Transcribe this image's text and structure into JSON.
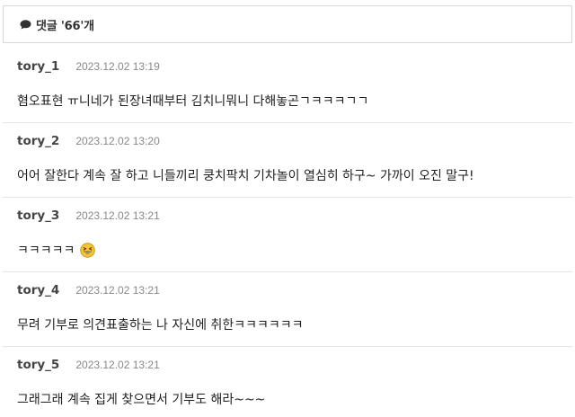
{
  "header": {
    "icon": "comment-bubble-icon",
    "title": "댓글 '66'개"
  },
  "comments": [
    {
      "author": "tory_1",
      "date": "2023.12.02 13:19",
      "text": "혐오표현 ㅠ니네가 된장녀때부터 김치니뭐니 다해놓곤ㄱㅋㅋㅋㄱㄱ"
    },
    {
      "author": "tory_2",
      "date": "2023.12.02 13:20",
      "text": "어어 잘한다 계속 잘 하고 니들끼리 쿵치팍치 기차놀이 열심히 하구~ 가까이 오진 말구!"
    },
    {
      "author": "tory_3",
      "date": "2023.12.02 13:21",
      "text": "ㅋㅋㅋㅋㅋ",
      "emoji": "grinning-squint-emoji"
    },
    {
      "author": "tory_4",
      "date": "2023.12.02 13:21",
      "text": "무려 기부로 의견표출하는 나 자신에 취한ㅋㅋㅋㅋㅋㅋ"
    },
    {
      "author": "tory_5",
      "date": "2023.12.02 13:21",
      "text": "그래그래 계속 집게 찾으면서 기부도 해라~~~"
    }
  ]
}
